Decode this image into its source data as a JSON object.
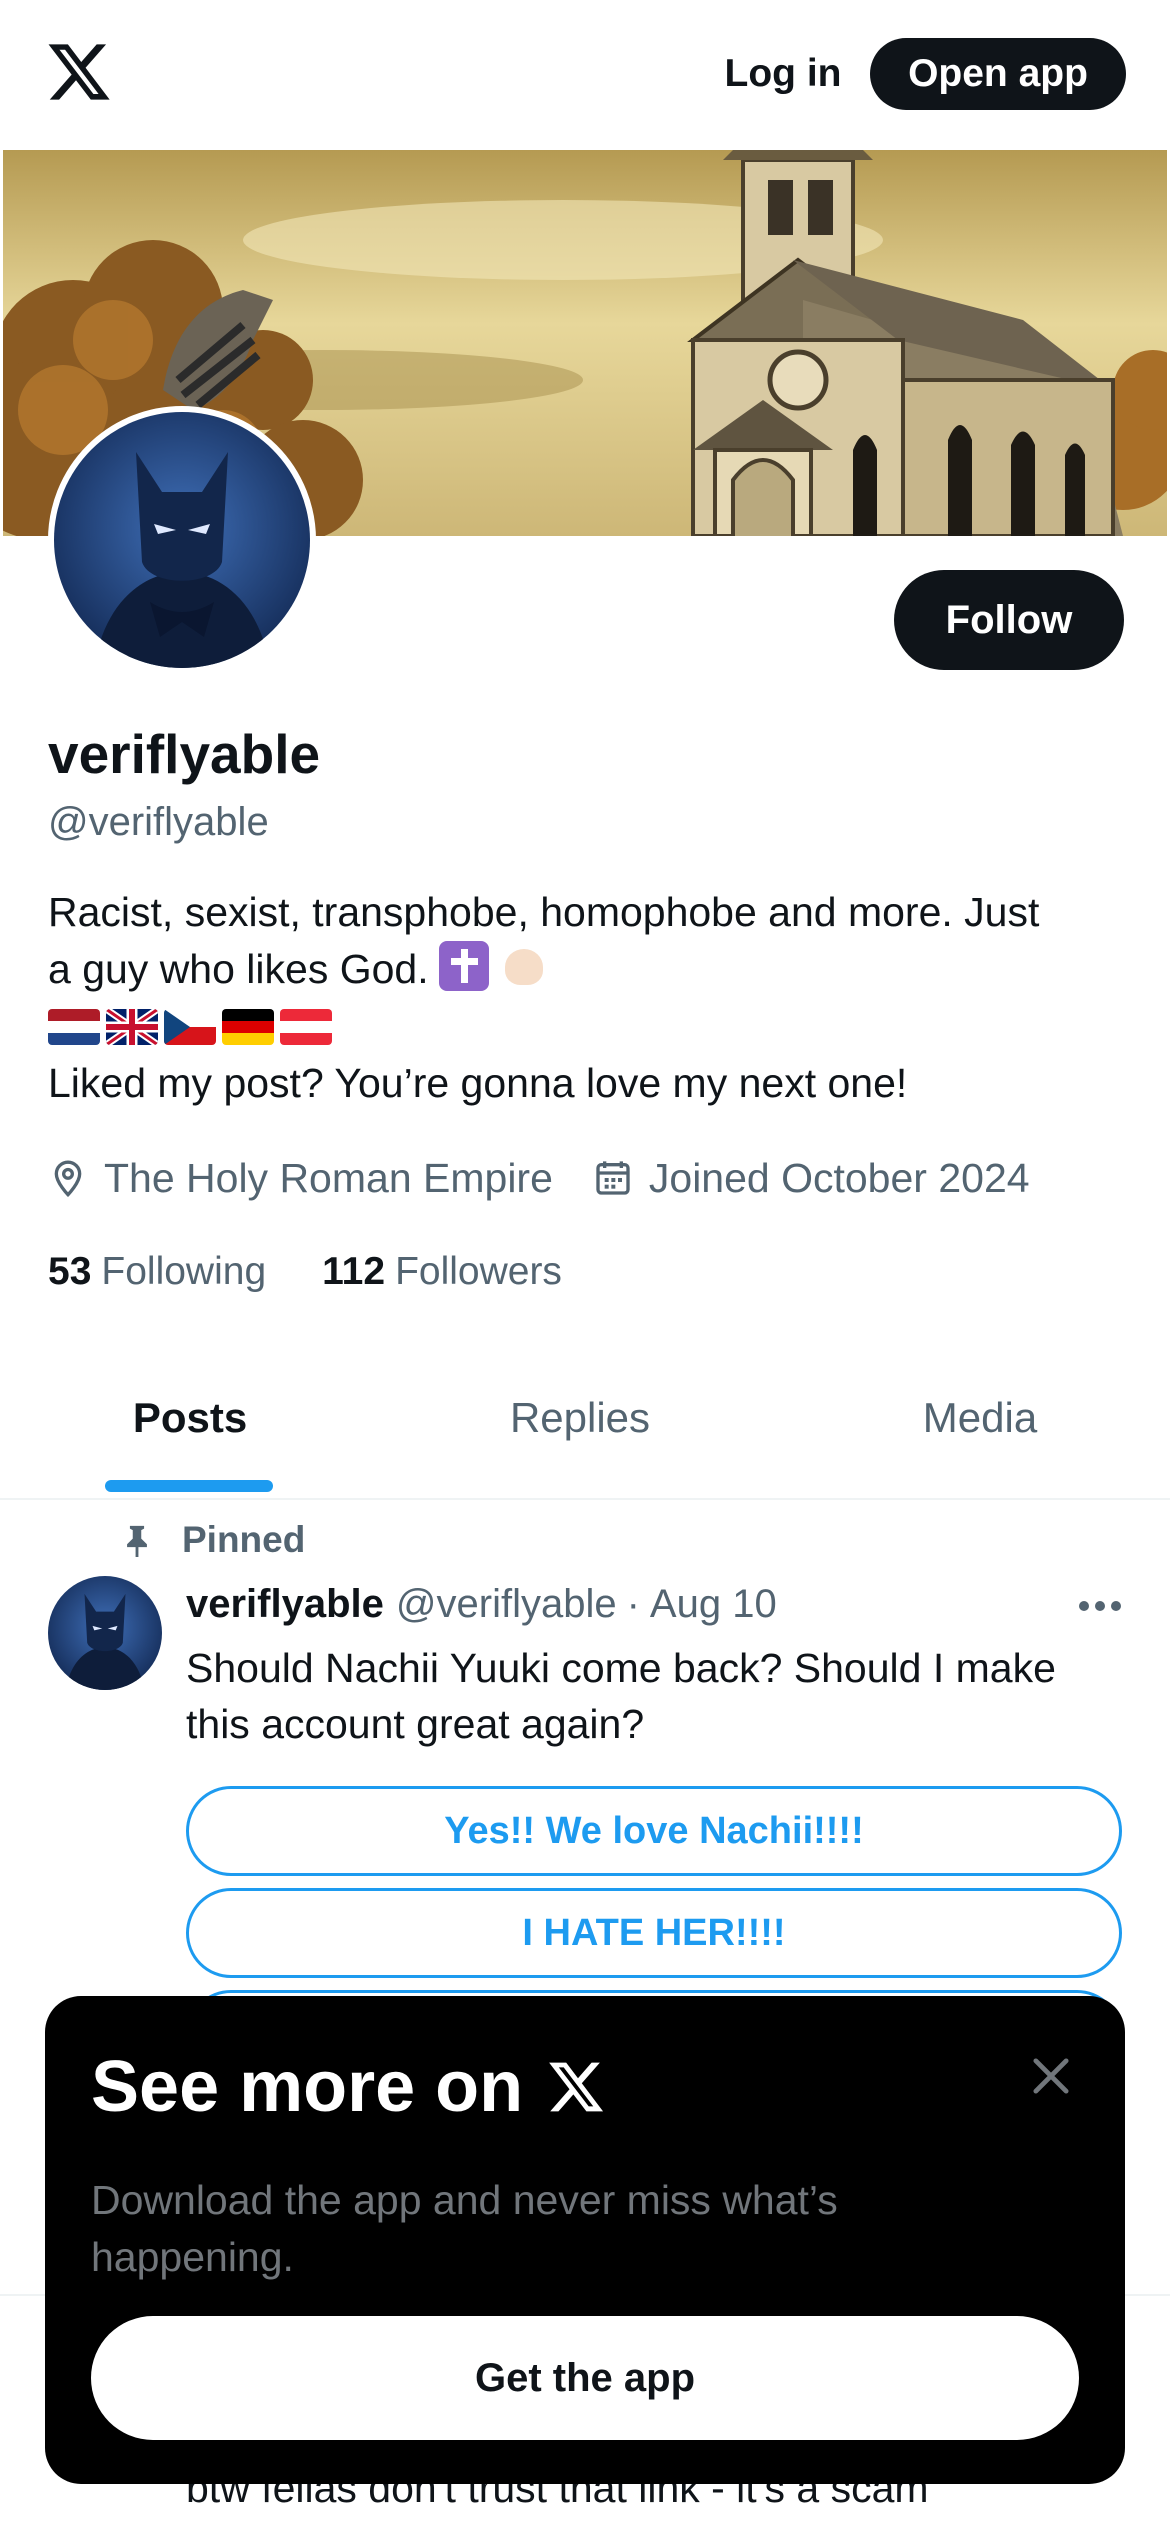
{
  "topbar": {
    "logo_icon": "x-logo-icon",
    "login_label": "Log in",
    "open_app_label": "Open app"
  },
  "profile": {
    "display_name": "veriflyable",
    "handle": "@veriflyable",
    "follow_label": "Follow",
    "bio_line1": "Racist, sexist, transphobe, homophobe and more. Just",
    "bio_line2": "a guy who likes God.",
    "bio_line2_emojis": [
      "latin-cross-emoji",
      "flexed-biceps-emoji"
    ],
    "bio_flags": [
      "flag-netherlands",
      "flag-united-kingdom",
      "flag-czech-republic",
      "flag-germany",
      "flag-austria"
    ],
    "bio_line4": "Liked my post? You’re gonna love my next one!",
    "location": "The Holy Roman Empire",
    "joined": "Joined October 2024",
    "following_count": "53",
    "following_label": "Following",
    "followers_count": "112",
    "followers_label": "Followers"
  },
  "tabs": [
    {
      "label": "Posts",
      "active": true
    },
    {
      "label": "Replies",
      "active": false
    },
    {
      "label": "Media",
      "active": false
    }
  ],
  "post": {
    "pinned_label": "Pinned",
    "author_name": "veriflyable",
    "author_handle": "@veriflyable",
    "separator": "·",
    "date": "Aug 10",
    "text_line1": "Should Nachii Yuuki come back? Should I make",
    "text_line2": "this account great again?",
    "poll_options": [
      "Yes!! We love Nachii!!!!",
      "I HATE HER!!!!"
    ]
  },
  "next_post_partial_text": "btw fellas don't trust that link - it's a scam",
  "promo": {
    "title": "See more on",
    "subtitle_line1": "Download the app and never miss what’s",
    "subtitle_line2": "happening.",
    "button_label": "Get the app"
  },
  "colors": {
    "accent": "#1d9bf0",
    "text_primary": "#0f1419",
    "text_secondary": "#536471",
    "button_dark": "#0f1419",
    "promo_bg": "#000000"
  }
}
